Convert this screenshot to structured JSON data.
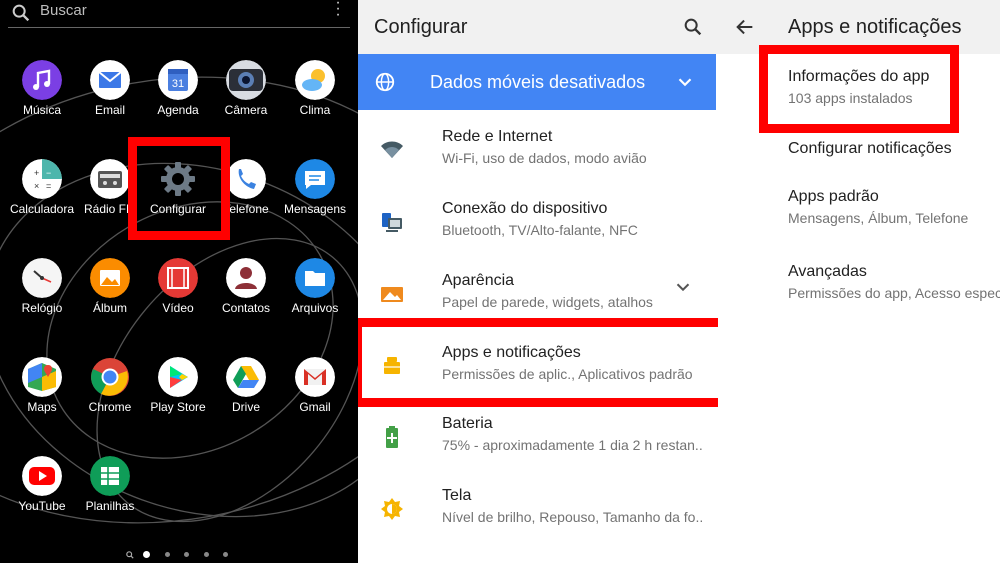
{
  "home": {
    "search_placeholder": "Buscar",
    "apps": [
      {
        "label": "Música"
      },
      {
        "label": "Email"
      },
      {
        "label": "Agenda",
        "badge": "31"
      },
      {
        "label": "Câmera"
      },
      {
        "label": "Clima"
      },
      {
        "label": "Calculadora"
      },
      {
        "label": "Rádio FM"
      },
      {
        "label": "Configurar"
      },
      {
        "label": "Telefone"
      },
      {
        "label": "Mensagens"
      },
      {
        "label": "Relógio"
      },
      {
        "label": "Álbum"
      },
      {
        "label": "Vídeo"
      },
      {
        "label": "Contatos"
      },
      {
        "label": "Arquivos"
      },
      {
        "label": "Maps"
      },
      {
        "label": "Chrome"
      },
      {
        "label": "Play Store"
      },
      {
        "label": "Drive"
      },
      {
        "label": "Gmail"
      },
      {
        "label": "YouTube"
      },
      {
        "label": "Planilhas"
      }
    ],
    "page_indicator": {
      "total": 5,
      "current": 1
    }
  },
  "settings": {
    "title": "Configurar",
    "banner": "Dados móveis desativados",
    "items": [
      {
        "title": "Rede e Internet",
        "subtitle": "Wi-Fi, uso de dados, modo avião",
        "icon": "wifi-icon"
      },
      {
        "title": "Conexão do dispositivo",
        "subtitle": "Bluetooth, TV/Alto-falante, NFC",
        "icon": "devices-icon"
      },
      {
        "title": "Aparência",
        "subtitle": "Papel de parede, widgets, atalhos",
        "icon": "wallpaper-icon"
      },
      {
        "title": "Apps e notificações",
        "subtitle": "Permissões de aplic., Aplicativos padrão",
        "icon": "apps-icon"
      },
      {
        "title": "Bateria",
        "subtitle": "75% - aproximadamente 1 dia 2 h restan...",
        "icon": "battery-icon"
      },
      {
        "title": "Tela",
        "subtitle": "Nível de brilho, Repouso, Tamanho da fo...",
        "icon": "brightness-icon"
      }
    ]
  },
  "apps_notif": {
    "title": "Apps e notificações",
    "items": [
      {
        "title": "Informações do app",
        "subtitle": "103 apps instalados"
      },
      {
        "title": "Configurar notificações",
        "subtitle": ""
      },
      {
        "title": "Apps padrão",
        "subtitle": "Mensagens, Álbum, Telefone"
      },
      {
        "title": "Avançadas",
        "subtitle": "Permissões do app, Acesso especial"
      }
    ]
  },
  "colors": {
    "highlight": "#ff0000",
    "banner": "#4285f4",
    "settings_icon": "#455a64"
  }
}
